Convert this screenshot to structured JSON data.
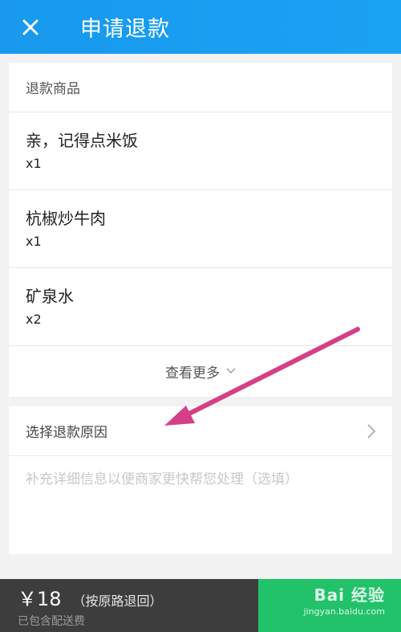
{
  "header": {
    "title": "申请退款",
    "close_icon": "close-icon"
  },
  "goods": {
    "section_label": "退款商品",
    "items": [
      {
        "name": "亲，记得点米饭",
        "qty": "x1"
      },
      {
        "name": "杭椒炒牛肉",
        "qty": "x1"
      },
      {
        "name": "矿泉水",
        "qty": "x2"
      }
    ],
    "more_label": "查看更多",
    "more_icon": "chevron-down-icon"
  },
  "reason": {
    "label": "选择退款原因",
    "chevron_icon": "chevron-right-icon",
    "placeholder": "补充详细信息以便商家更快帮您处理（选填）"
  },
  "annotation": {
    "arrow_color": "#d63f87"
  },
  "footer": {
    "price": "￥18",
    "refund_mode": "（按原路退回）",
    "fee_note": "已包含配送费",
    "submit_label": ""
  },
  "watermark": {
    "brand": "Bai 经验",
    "url": "jingyan.baidu.com"
  },
  "colors": {
    "header": "#1899ee",
    "submit": "#21c26a",
    "footer_dark": "#3d3d3d"
  }
}
